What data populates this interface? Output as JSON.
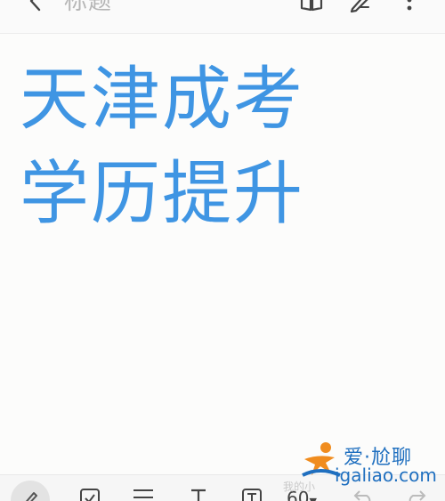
{
  "header": {
    "title_placeholder": "标题"
  },
  "note": {
    "lines": [
      "天津成考",
      "学历提升"
    ],
    "text_color": "#3f95e3"
  },
  "toolbar": {
    "pen_size": "60"
  },
  "watermark": {
    "brand": "爱·尬聊",
    "url": "igaliao.com",
    "faint_text": "我的小"
  },
  "icons": [
    "back-icon",
    "reading-mode-icon",
    "pen-icon",
    "more-icon",
    "handwriting-pen-icon",
    "checkbox-icon",
    "list-icon",
    "text-icon",
    "text-box-icon",
    "undo-icon",
    "redo-icon"
  ]
}
